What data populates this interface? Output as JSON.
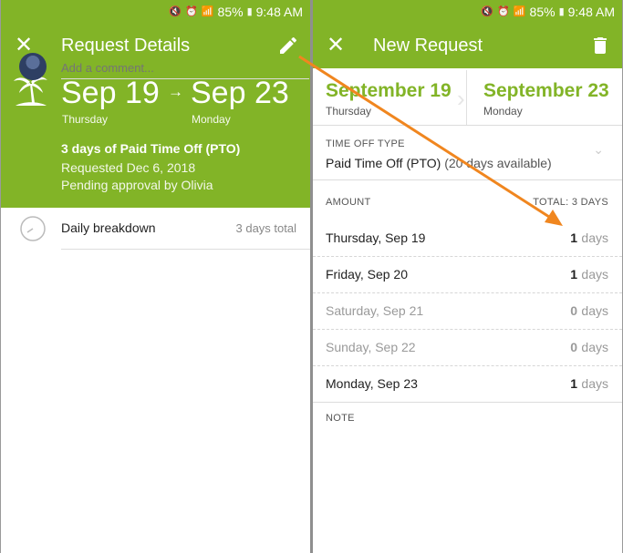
{
  "status_bar": {
    "battery": "85%",
    "time": "9:48 AM"
  },
  "left": {
    "title": "Request Details",
    "close_glyph": "✕",
    "icons": {
      "close": "close-icon",
      "edit": "pencil-icon",
      "palm": "palm-tree-icon",
      "clock": "clock-icon"
    },
    "start_date": "Sep 19",
    "end_date": "Sep 23",
    "arrow_glyph": "→",
    "start_day": "Thursday",
    "end_day": "Monday",
    "summary": "3 days of Paid Time Off (PTO)",
    "requested": "Requested Dec 6, 2018",
    "pending": "Pending approval by Olivia",
    "breakdown_label": "Daily breakdown",
    "breakdown_total": "3 days total",
    "comment_placeholder": "Add a comment..."
  },
  "right": {
    "title": "New Request",
    "close_glyph": "✕",
    "icons": {
      "close": "close-icon",
      "delete": "trash-icon"
    },
    "start_date": "September 19",
    "start_day": "Thursday",
    "end_date": "September 23",
    "end_day": "Monday",
    "time_off_type_label": "TIME OFF TYPE",
    "time_off_type_value": "Paid Time Off (PTO)",
    "time_off_type_available": "(20 days available)",
    "amount_label": "AMOUNT",
    "total_label": "TOTAL: 3 DAYS",
    "days": [
      {
        "name": "Thursday, Sep 19",
        "count": "1",
        "unit": "days",
        "weekend": false
      },
      {
        "name": "Friday, Sep 20",
        "count": "1",
        "unit": "days",
        "weekend": false
      },
      {
        "name": "Saturday, Sep 21",
        "count": "0",
        "unit": "days",
        "weekend": true
      },
      {
        "name": "Sunday, Sep 22",
        "count": "0",
        "unit": "days",
        "weekend": true
      },
      {
        "name": "Monday, Sep 23",
        "count": "1",
        "unit": "days",
        "weekend": false
      }
    ],
    "note_label": "NOTE"
  },
  "colors": {
    "brand_green": "#82b427",
    "annotation_arrow": "#f0861f"
  }
}
